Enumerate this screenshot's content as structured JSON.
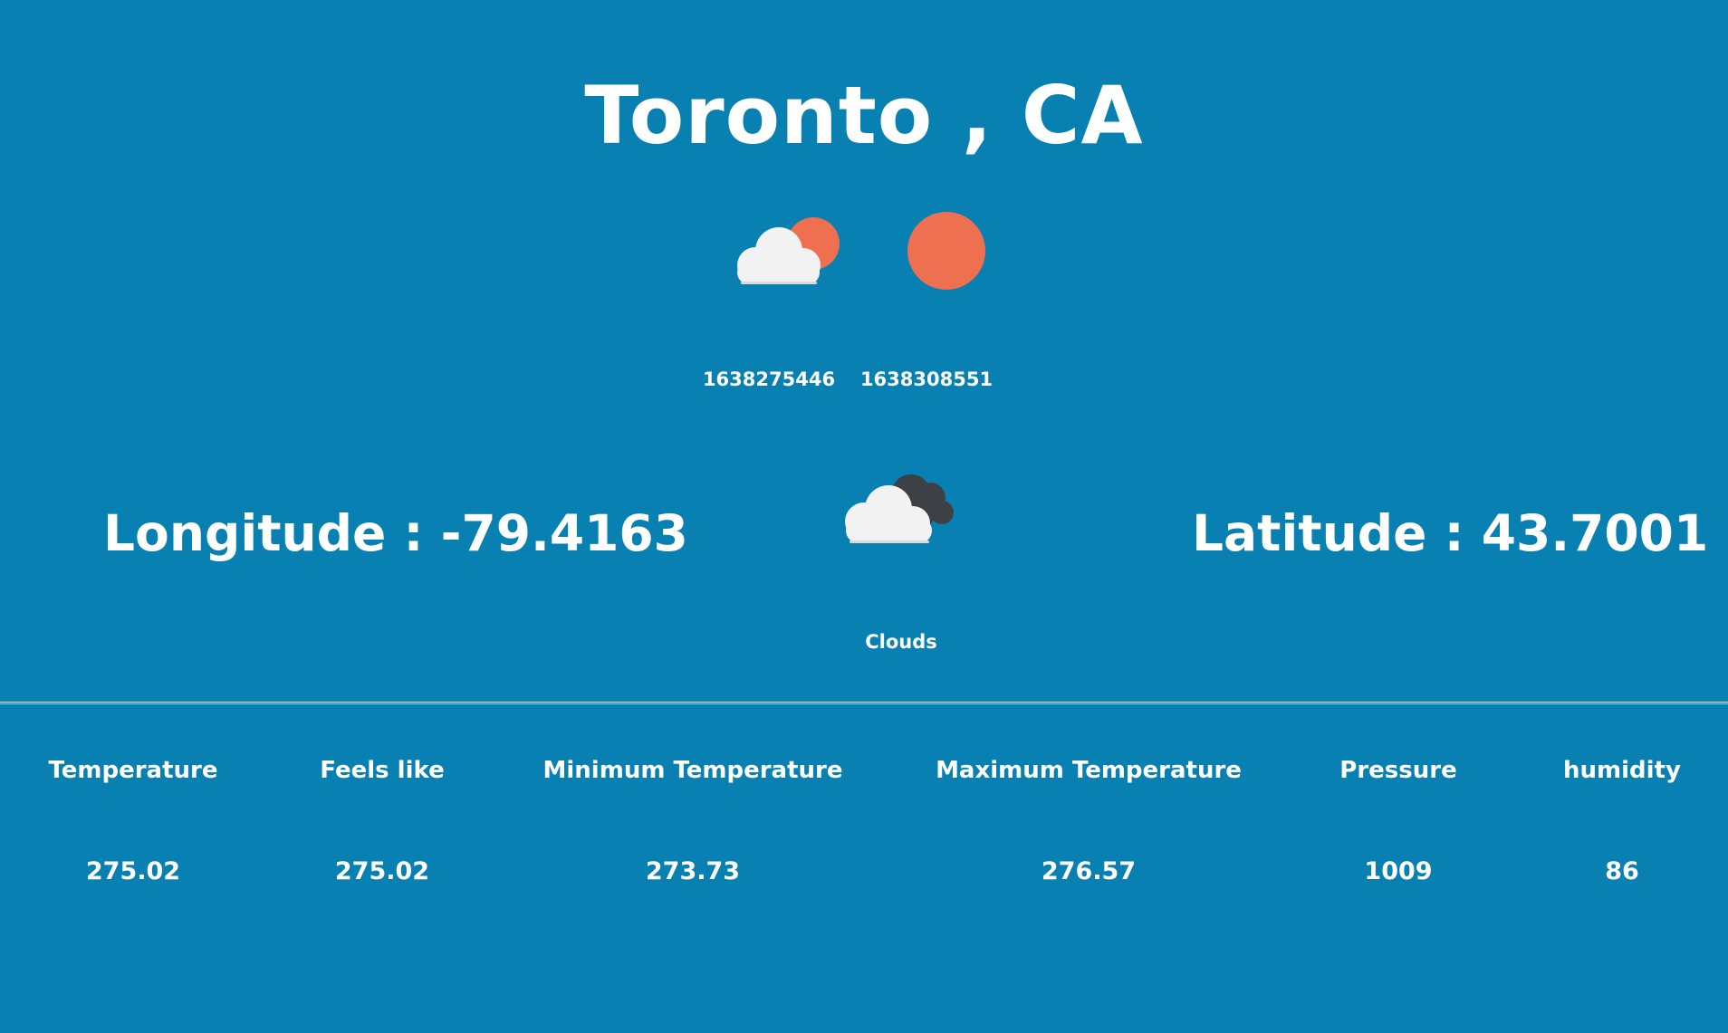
{
  "location": {
    "title": "Toronto , CA"
  },
  "sun": {
    "sunrise_icon": "partly-cloudy-sun-icon",
    "sunset_icon": "sun-icon",
    "sunrise_value": "1638275446",
    "sunset_value": "1638308551"
  },
  "coordinates": {
    "longitude_text": "Longitude : -79.4163",
    "latitude_text": "Latitude : 43.7001"
  },
  "condition": {
    "icon": "broken-clouds-icon",
    "label": "Clouds"
  },
  "stats": [
    {
      "label": "Temperature",
      "value": "275.02"
    },
    {
      "label": "Feels like",
      "value": "275.02"
    },
    {
      "label": "Minimum Temperature",
      "value": "273.73"
    },
    {
      "label": "Maximum Temperature",
      "value": "276.57"
    },
    {
      "label": "Pressure",
      "value": "1009"
    },
    {
      "label": "humidity",
      "value": "86"
    }
  ],
  "colors": {
    "background": "#0880b1",
    "sun": "#ee7051",
    "cloud": "#f2f2f2",
    "dark_cloud": "#3d4044"
  }
}
